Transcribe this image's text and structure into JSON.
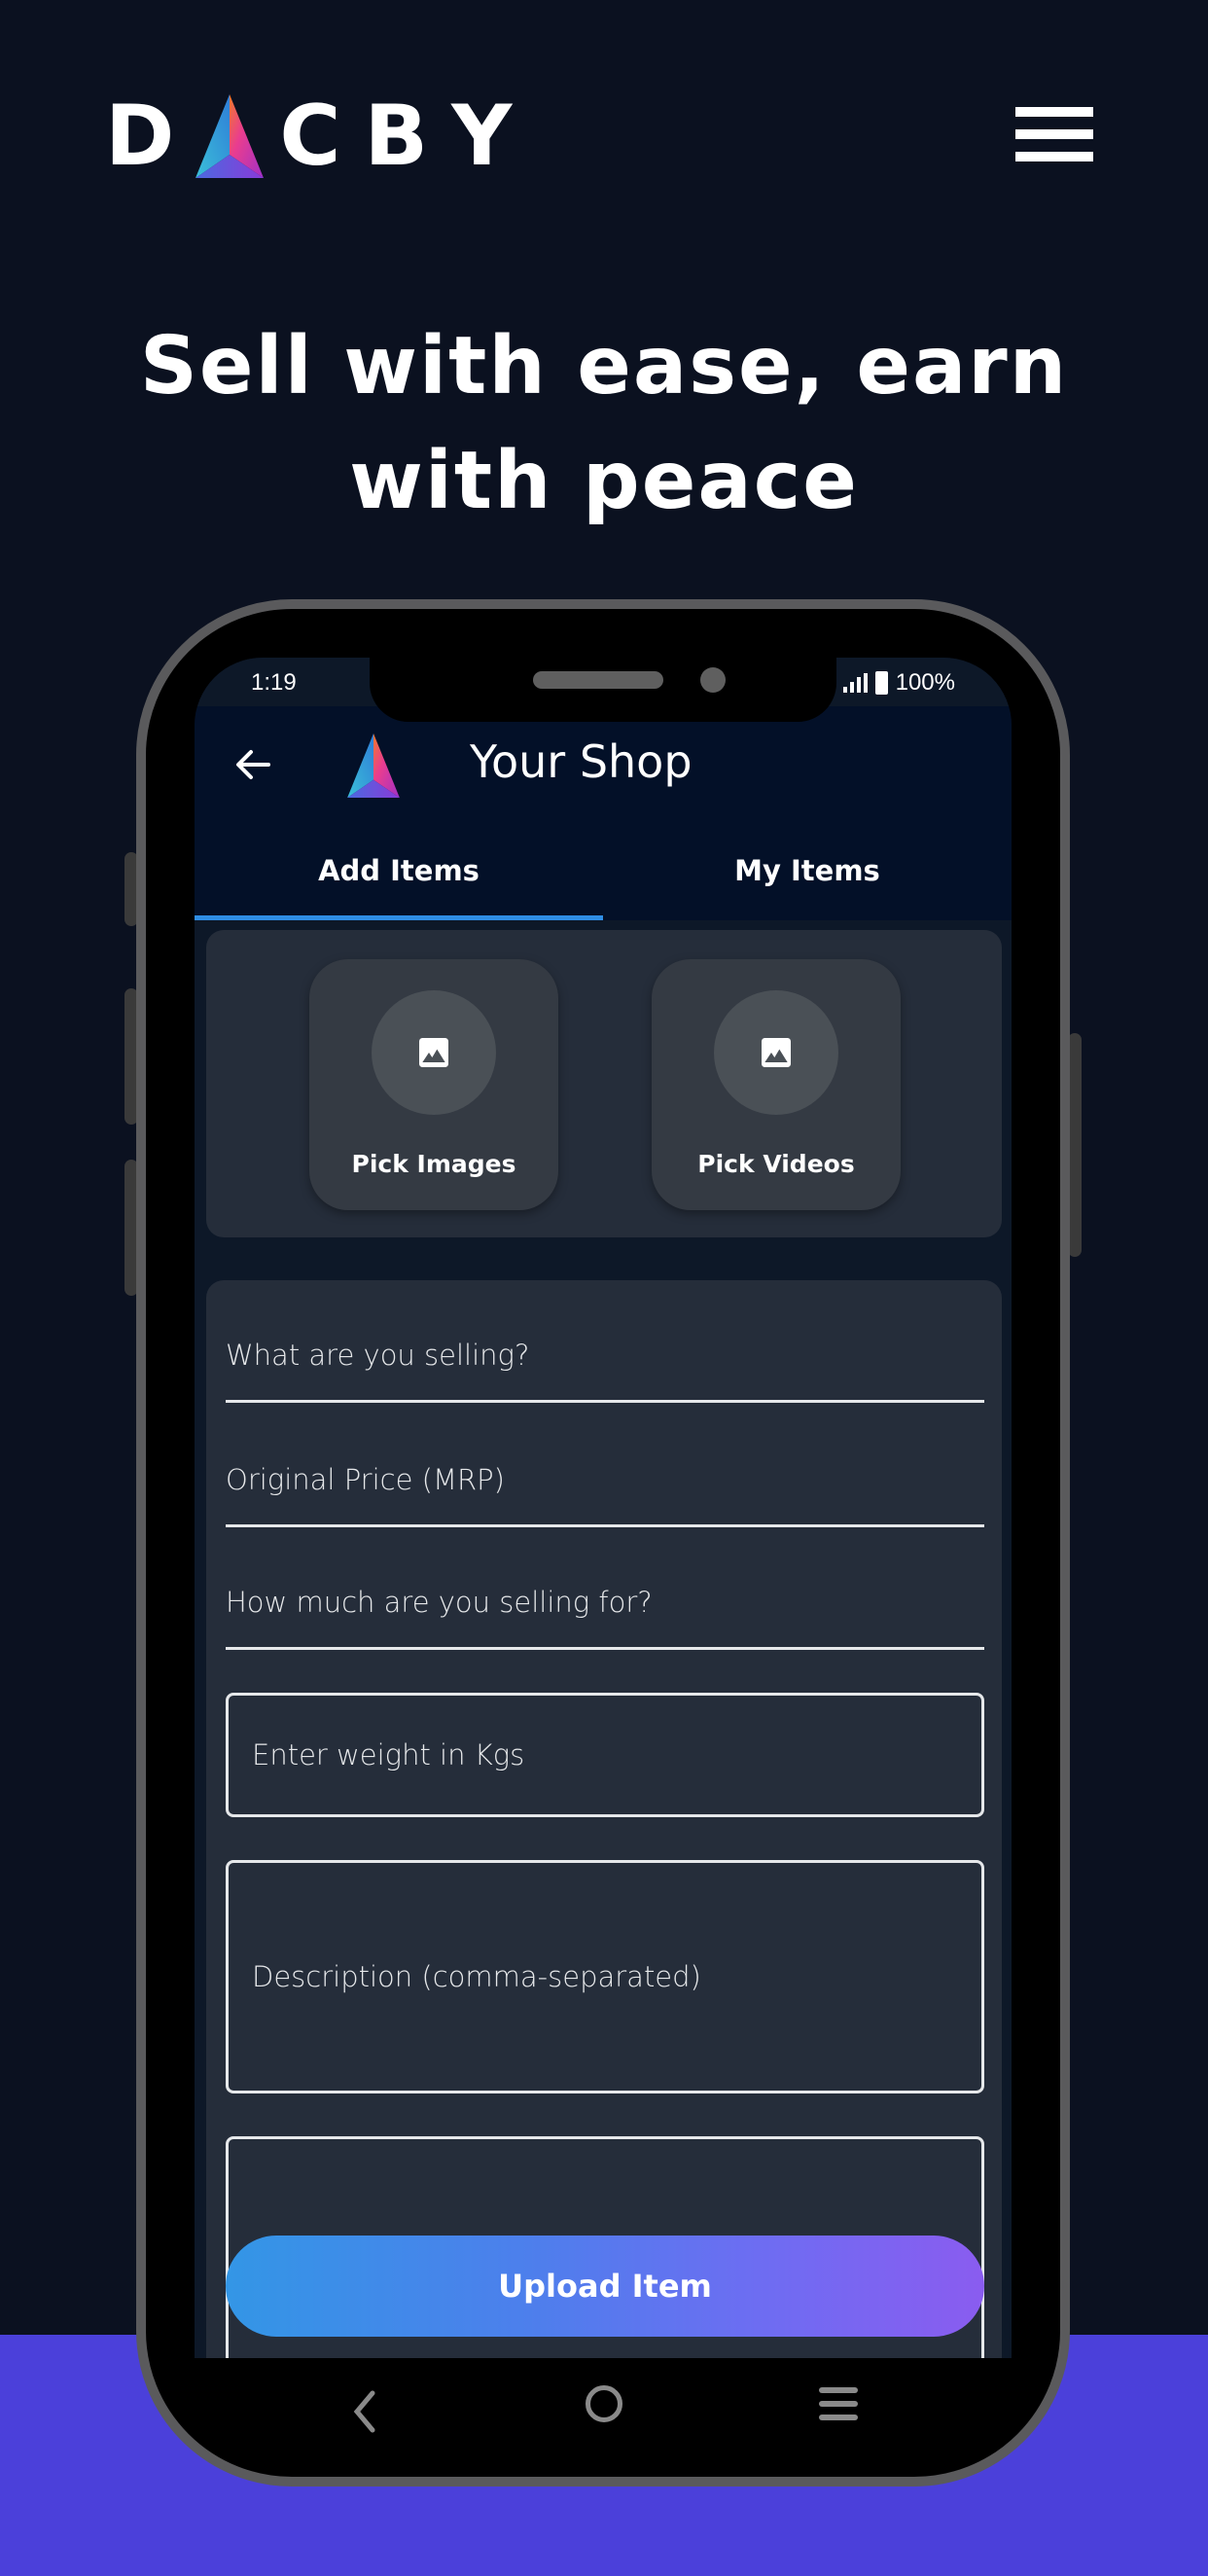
{
  "site": {
    "brand_letters": [
      "D",
      "C",
      "B",
      "Y"
    ],
    "menu_icon": "hamburger-menu-icon",
    "headline_line1": "Sell with ease, earn",
    "headline_line2": "with peace"
  },
  "status_bar": {
    "time": "1:19",
    "battery": "100%"
  },
  "app": {
    "title": "Your Shop",
    "tabs": [
      {
        "label": "Add Items",
        "active": true
      },
      {
        "label": "My Items",
        "active": false
      }
    ],
    "media": {
      "pick_images_label": "Pick Images",
      "pick_videos_label": "Pick Videos"
    },
    "form": {
      "item_name_placeholder": "What are you selling?",
      "original_price_placeholder": "Original Price (MRP)",
      "selling_price_placeholder": "How much are you selling for?",
      "weight_placeholder": "Enter weight in Kgs",
      "description_placeholder": "Description (comma-separated)"
    },
    "upload_label": "Upload Item"
  },
  "colors": {
    "page_bg": "#0b1120",
    "band": "#4b40da",
    "accent_tab": "#2f8de4",
    "button_gradient_start": "#3396e6",
    "button_gradient_end": "#8a5cf0"
  }
}
